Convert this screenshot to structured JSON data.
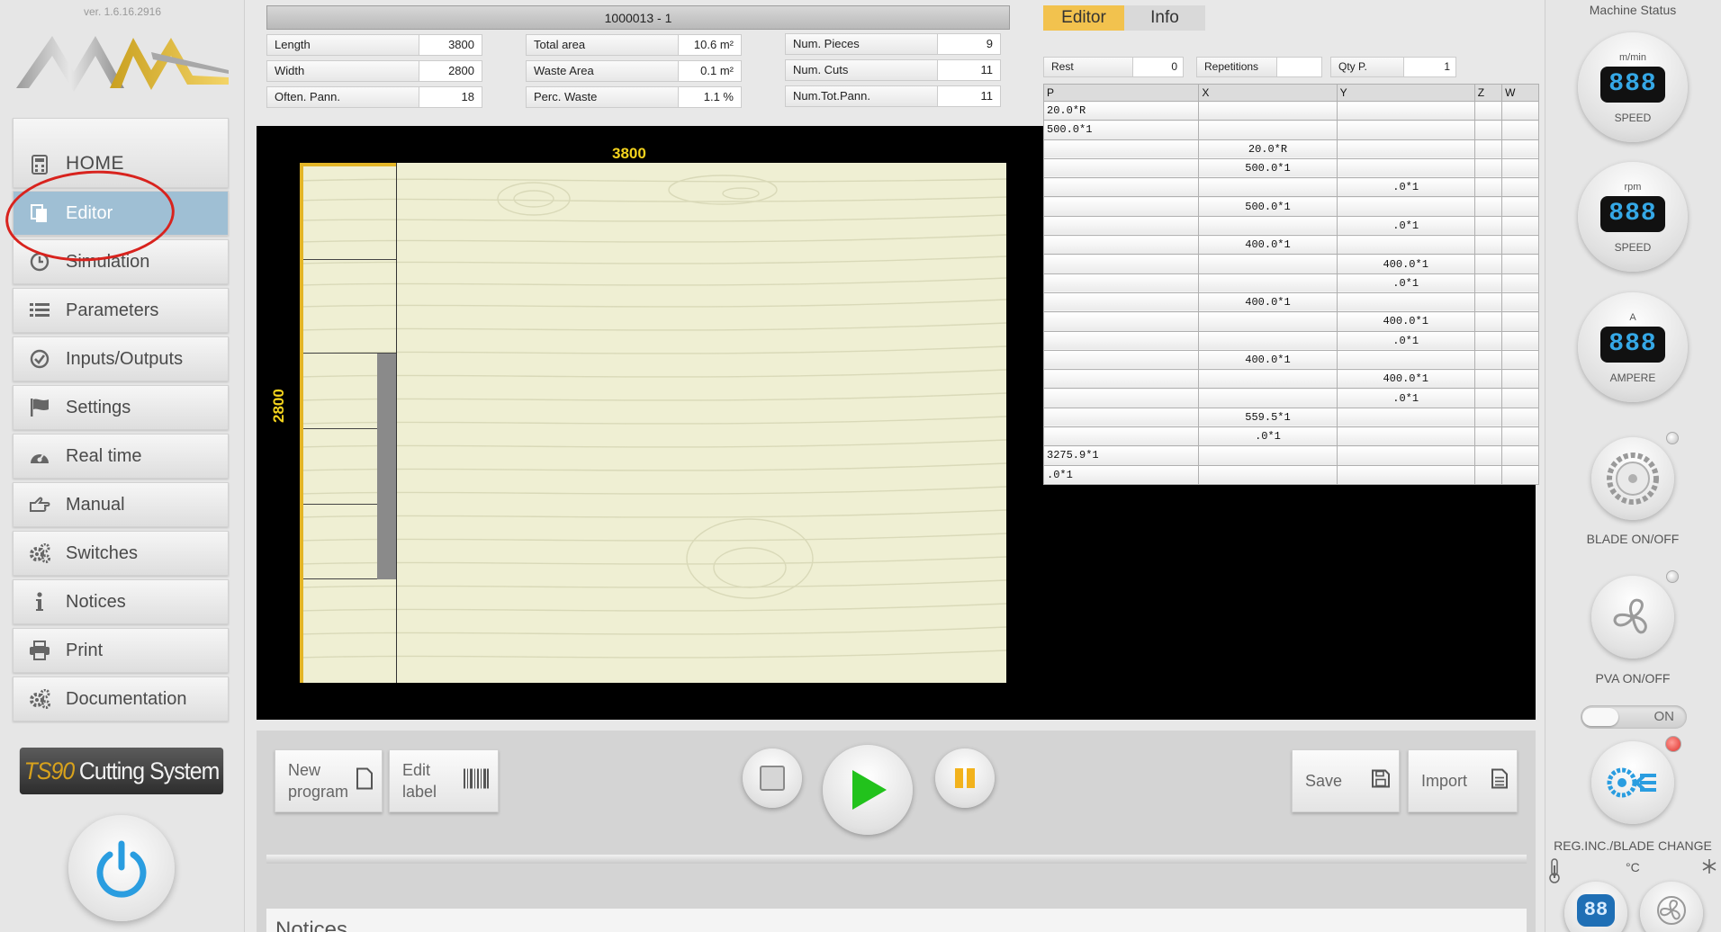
{
  "app": {
    "version": "ver. 1.6.16.2916",
    "logo_text": "MM",
    "brand_model": "TS90",
    "brand_name": "Cutting System"
  },
  "sidebar": {
    "items": [
      {
        "label": "HOME",
        "icon": "calculator-icon"
      },
      {
        "label": "Editor",
        "icon": "copy-icon"
      },
      {
        "label": "Simulation",
        "icon": "clock-icon"
      },
      {
        "label": "Parameters",
        "icon": "list-icon"
      },
      {
        "label": "Inputs/Outputs",
        "icon": "check-circle-icon"
      },
      {
        "label": "Settings",
        "icon": "flag-icon"
      },
      {
        "label": "Real time",
        "icon": "dashboard-icon"
      },
      {
        "label": "Manual",
        "icon": "hand-pointer-icon"
      },
      {
        "label": "Switches",
        "icon": "gears-icon"
      },
      {
        "label": "Notices",
        "icon": "info-icon"
      },
      {
        "label": "Print",
        "icon": "printer-icon"
      },
      {
        "label": "Documentation",
        "icon": "gears-icon"
      }
    ]
  },
  "program": {
    "title": "1000013 - 1",
    "length_label": "Length",
    "length": "3800",
    "width_label": "Width",
    "width": "2800",
    "often_label": "Often. Pann.",
    "often": "18",
    "total_area_label": "Total area",
    "total_area": "10.6 m²",
    "waste_area_label": "Waste Area",
    "waste_area": "0.1 m²",
    "perc_waste_label": "Perc. Waste",
    "perc_waste": "1.1 %",
    "num_pieces_label": "Num. Pieces",
    "num_pieces": "9",
    "num_cuts_label": "Num. Cuts",
    "num_cuts": "11",
    "num_tot_label": "Num.Tot.Pann.",
    "num_tot": "11"
  },
  "canvas": {
    "dim_width": "3800",
    "dim_height": "2800"
  },
  "editor": {
    "tabs": [
      "Editor",
      "Info"
    ],
    "rest_label": "Rest",
    "rest": "0",
    "repetitions_label": "Repetitions",
    "repetitions": "",
    "qty_label": "Qty P.",
    "qty": "1",
    "columns": [
      "P",
      "X",
      "Y",
      "Z",
      "W"
    ],
    "rows": [
      [
        "20.0*R",
        "",
        "",
        "",
        ""
      ],
      [
        "500.0*1",
        "",
        "",
        "",
        ""
      ],
      [
        "",
        "20.0*R",
        "",
        "",
        ""
      ],
      [
        "",
        "500.0*1",
        "",
        "",
        ""
      ],
      [
        "",
        "",
        ".0*1",
        "",
        ""
      ],
      [
        "",
        "500.0*1",
        "",
        "",
        ""
      ],
      [
        "",
        "",
        ".0*1",
        "",
        ""
      ],
      [
        "",
        "400.0*1",
        "",
        "",
        ""
      ],
      [
        "",
        "",
        "400.0*1",
        "",
        ""
      ],
      [
        "",
        "",
        ".0*1",
        "",
        ""
      ],
      [
        "",
        "400.0*1",
        "",
        "",
        ""
      ],
      [
        "",
        "",
        "400.0*1",
        "",
        ""
      ],
      [
        "",
        "",
        ".0*1",
        "",
        ""
      ],
      [
        "",
        "400.0*1",
        "",
        "",
        ""
      ],
      [
        "",
        "",
        "400.0*1",
        "",
        ""
      ],
      [
        "",
        "",
        ".0*1",
        "",
        ""
      ],
      [
        "",
        "559.5*1",
        "",
        "",
        ""
      ],
      [
        "",
        ".0*1",
        "",
        "",
        ""
      ],
      [
        "3275.9*1",
        "",
        "",
        "",
        ""
      ],
      [
        ".0*1",
        "",
        "",
        "",
        ""
      ]
    ]
  },
  "controls": {
    "new_program": [
      "New",
      "program"
    ],
    "edit_label": [
      "Edit",
      "label"
    ],
    "save": "Save",
    "import": "Import",
    "notices_title": "Notices"
  },
  "machine": {
    "title": "Machine Status",
    "gauges": [
      {
        "unit": "m/min",
        "display": "888",
        "label": "SPEED"
      },
      {
        "unit": "rpm",
        "display": "888",
        "label": "SPEED"
      },
      {
        "unit": "A",
        "display": "888",
        "label": "AMPERE"
      }
    ],
    "blade_label": "BLADE ON/OFF",
    "pva_label": "PVA ON/OFF",
    "toggle_label": "ON",
    "reg_label": "REG.INC./BLADE CHANGE",
    "temp_unit": "°C",
    "temp_display": "88",
    "status_led_color": "#e0312b"
  }
}
